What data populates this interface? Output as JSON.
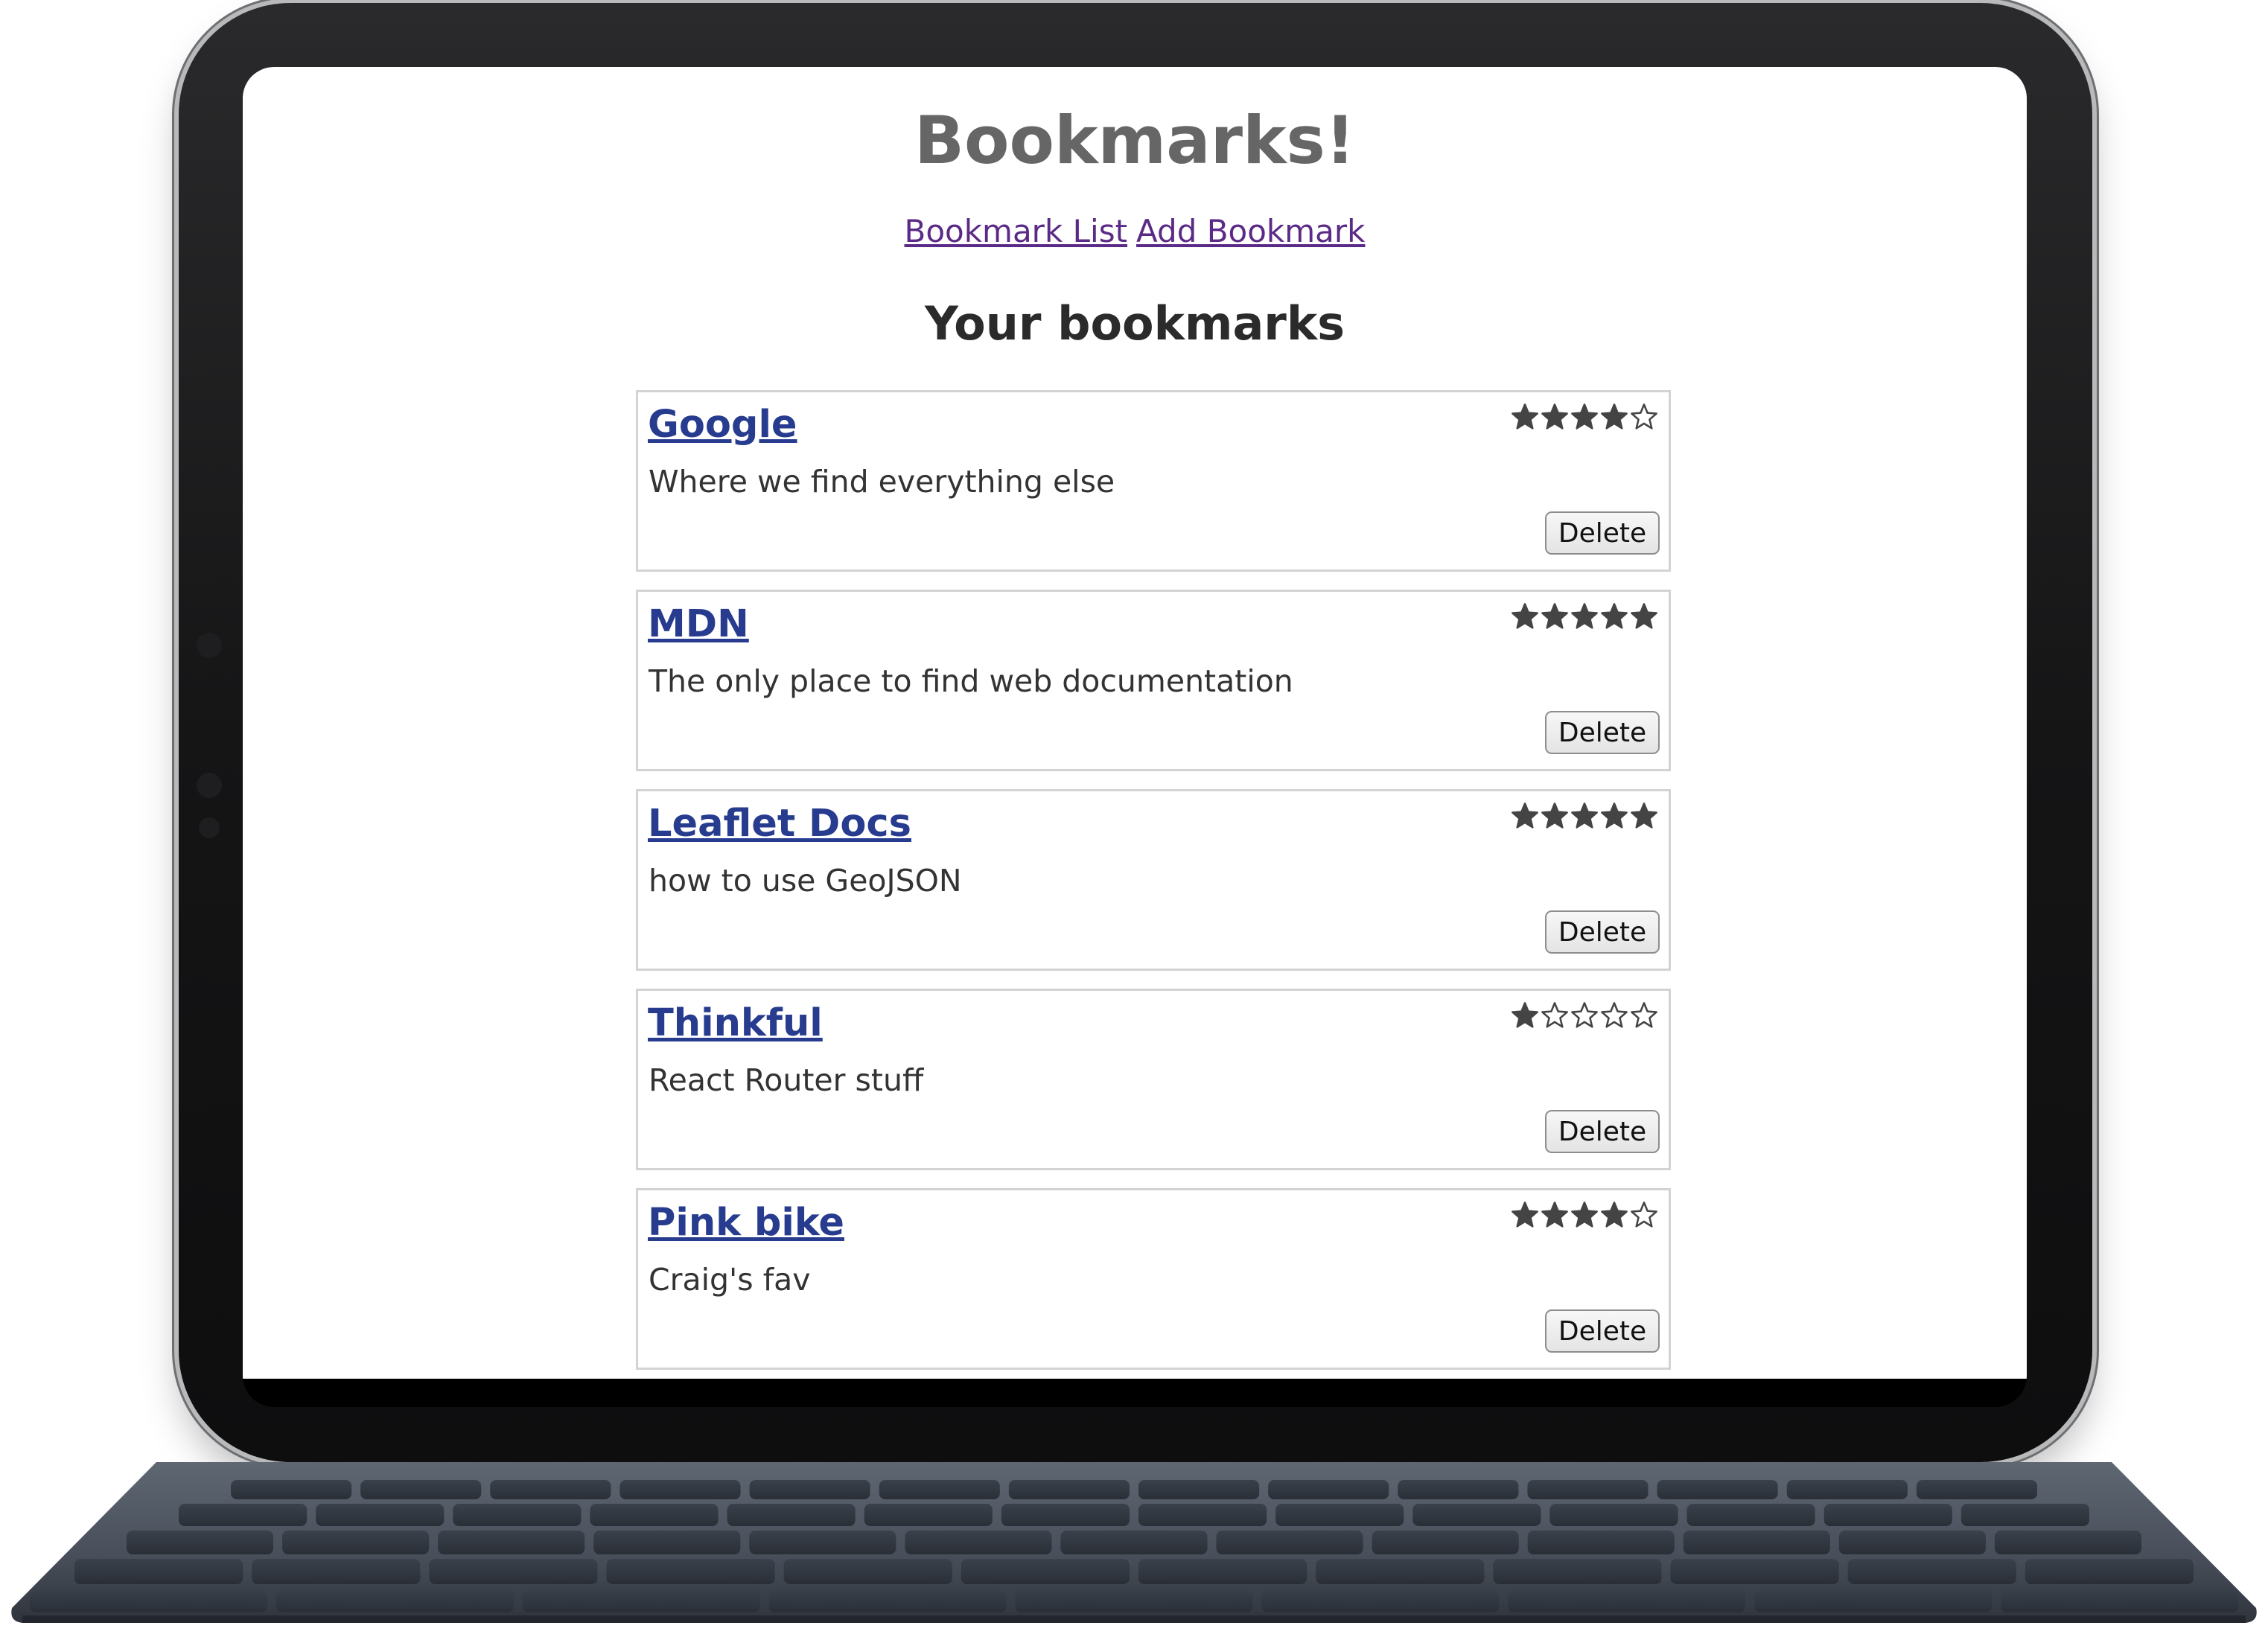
{
  "app": {
    "title": "Bookmarks!"
  },
  "nav": {
    "list_label": "Bookmark List",
    "add_label": "Add Bookmark"
  },
  "main": {
    "section_title": "Your bookmarks"
  },
  "bookmarks": [
    {
      "title": "Google",
      "description": "Where we find everything else",
      "rating": 4,
      "delete_label": "Delete"
    },
    {
      "title": "MDN",
      "description": "The only place to find web documentation",
      "rating": 5,
      "delete_label": "Delete"
    },
    {
      "title": "Leaflet Docs",
      "description": "how to use GeoJSON",
      "rating": 5,
      "delete_label": "Delete"
    },
    {
      "title": "Thinkful",
      "description": "React Router stuff",
      "rating": 1,
      "delete_label": "Delete"
    },
    {
      "title": "Pink bike",
      "description": "Craig's fav",
      "rating": 4,
      "delete_label": "Delete"
    }
  ],
  "rating_max": 5,
  "icons": {
    "filled_star": "star-filled-icon",
    "empty_star": "star-empty-icon"
  },
  "colors": {
    "title_gray": "#666666",
    "nav_link": "#5b2a86",
    "bookmark_link": "#273c8f",
    "star": "#444444",
    "card_border": "#d3d3d3"
  }
}
